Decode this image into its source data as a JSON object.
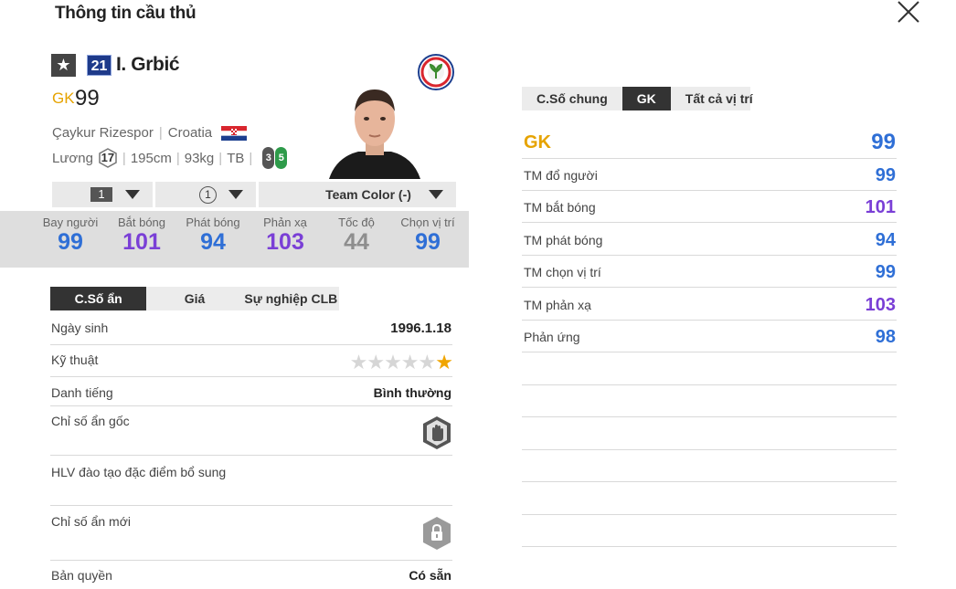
{
  "window": {
    "title": "Thông tin cầu thủ"
  },
  "player": {
    "star_glyph": "★",
    "number": "21",
    "name": "I. Grbić",
    "position": "GK",
    "overall": "99",
    "club": "Çaykur Rizespor",
    "nation": "Croatia",
    "salary_label": "Lương",
    "salary": "17",
    "height": "195cm",
    "weight": "93kg",
    "body_type": "TB",
    "left_foot": "3",
    "right_foot": "5"
  },
  "selectors": {
    "upgrade": "1",
    "level": "1",
    "team_color": "Team Color (-)"
  },
  "gk_stats": [
    {
      "name": "Bay người",
      "value": "99",
      "color": "#2f6fd6"
    },
    {
      "name": "Bắt bóng",
      "value": "101",
      "color": "#7a3fd6"
    },
    {
      "name": "Phát bóng",
      "value": "94",
      "color": "#2f6fd6"
    },
    {
      "name": "Phản xạ",
      "value": "103",
      "color": "#7a3fd6"
    },
    {
      "name": "Tốc độ",
      "value": "44",
      "color": "#8e8e8e"
    },
    {
      "name": "Chọn vị trí",
      "value": "99",
      "color": "#2f6fd6"
    }
  ],
  "left_tabs": [
    "C.Số ẩn",
    "Giá",
    "Sự nghiệp CLB"
  ],
  "info": {
    "birth_label": "Ngày sinh",
    "birth_value": "1996.1.18",
    "skill_label": "Kỹ thuật",
    "skill_stars": 1,
    "rep_label": "Danh tiếng",
    "rep_value": "Bình thường",
    "hidden_label": "Chỉ số ẩn gốc",
    "coach_label": "HLV đào tạo đặc điểm bổ sung",
    "new_hidden_label": "Chỉ số ẩn mới",
    "license_label": "Bản quyền",
    "license_value": "Có sẵn"
  },
  "right_tabs": [
    "C.Số chung",
    "GK",
    "Tất cả vị trí"
  ],
  "right_header": {
    "label": "GK",
    "value": "99"
  },
  "right_stats": [
    {
      "label": "TM đổ người",
      "value": "99",
      "color": "#2f6fd6"
    },
    {
      "label": "TM bắt bóng",
      "value": "101",
      "color": "#7a3fd6"
    },
    {
      "label": "TM phát bóng",
      "value": "94",
      "color": "#2f6fd6"
    },
    {
      "label": "TM chọn vị trí",
      "value": "99",
      "color": "#2f6fd6"
    },
    {
      "label": "TM phản xạ",
      "value": "103",
      "color": "#7a3fd6"
    },
    {
      "label": "Phản ứng",
      "value": "98",
      "color": "#2f6fd6"
    }
  ],
  "colors": {
    "gold": "#e6a300",
    "blue": "#2f6fd6",
    "purple": "#7a3fd6"
  }
}
